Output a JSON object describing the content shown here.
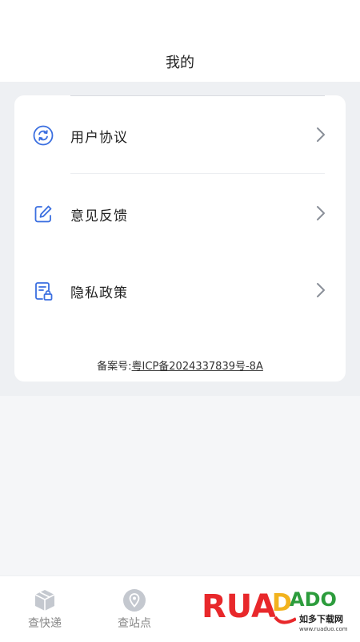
{
  "header": {
    "title": "我的"
  },
  "menu": {
    "items": [
      {
        "label": "用户协议",
        "icon": "refresh-circle-icon"
      },
      {
        "label": "意见反馈",
        "icon": "edit-note-icon"
      },
      {
        "label": "隐私政策",
        "icon": "document-lock-icon"
      }
    ]
  },
  "footer": {
    "icp_prefix": "备案号:",
    "icp_number": "粤ICP备2024337839号-8A"
  },
  "tabs": [
    {
      "label": "查快递",
      "icon": "package-icon"
    },
    {
      "label": "查站点",
      "icon": "location-pin-icon"
    }
  ],
  "watermark": {
    "brand": "RUANDADO",
    "cn_text": "如多下载网",
    "url": "www.ruaduo.com"
  },
  "colors": {
    "accent": "#3b6fe0",
    "chevron": "#8a8f99",
    "tab_icon": "#b8bcc4"
  }
}
